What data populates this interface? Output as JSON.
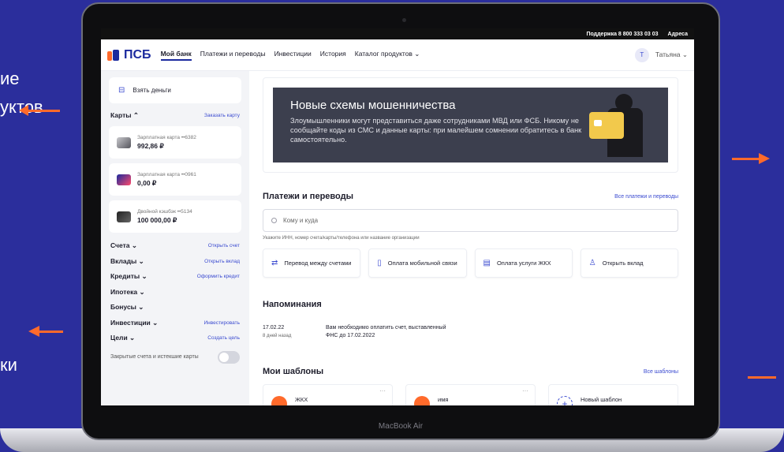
{
  "background": {
    "left_text_top": "ие\nуктов",
    "left_text_bottom": "ки"
  },
  "laptop_brand": "MacBook Air",
  "topbar": {
    "support": "Поддержка 8 800 333 03 03",
    "addresses": "Адреса"
  },
  "header": {
    "logo": "ПСБ",
    "nav": [
      "Мой банк",
      "Платежи и переводы",
      "Инвестиции",
      "История",
      "Каталог продуктов ⌄"
    ],
    "user_initial": "Т",
    "user_name": "Татьяна ⌄"
  },
  "sidebar": {
    "take_money": "Взять деньги",
    "cards_title": "Карты ⌃",
    "cards_link": "Заказать карту",
    "accounts": [
      {
        "name": "Зарплатная карта ••6382",
        "balance": "992,86 ₽"
      },
      {
        "name": "Зарплатная карта ••0961",
        "balance": "0,00 ₽"
      },
      {
        "name": "Двойной кэшбэк ••5134",
        "balance": "100 000,00 ₽"
      }
    ],
    "sections": [
      {
        "label": "Счета ⌄",
        "link": "Открыть счет"
      },
      {
        "label": "Вклады ⌄",
        "link": "Открыть вклад"
      },
      {
        "label": "Кредиты ⌄",
        "link": "Оформить кредит"
      },
      {
        "label": "Ипотека ⌄",
        "link": ""
      },
      {
        "label": "Бонусы ⌄",
        "link": ""
      },
      {
        "label": "Инвестиции ⌄",
        "link": "Инвестировать"
      },
      {
        "label": "Цели ⌄",
        "link": "Создать цель"
      }
    ],
    "closed_label": "Закрытые счета и истекшие карты"
  },
  "banner": {
    "title": "Новые схемы мошенничества",
    "text": "Злоумышленники могут представиться даже сотрудниками МВД или ФСБ. Никому не сообщайте коды из СМС и данные карты: при малейшем сомнении обратитесь в банк самостоятельно."
  },
  "payments": {
    "title": "Платежи и переводы",
    "all_link": "Все платежи и переводы",
    "search_placeholder": "Кому и куда",
    "hint": "Укажите ИНН, номер счета/карты/телефона или название организации",
    "actions": [
      "Перевод между счетами",
      "Оплата мобильной связи",
      "Оплата услуги ЖКХ",
      "Открыть вклад"
    ]
  },
  "reminders": {
    "title": "Напоминания",
    "date": "17.02.22",
    "ago": "8 дней назад",
    "text_line1": "Вам необходимо оплатить счет, выставленный",
    "text_line2": "ФНС до 17.02.2022"
  },
  "templates": {
    "title": "Мои шаблоны",
    "all_link": "Все шаблоны",
    "items": [
      "ЖКХ",
      "имя",
      "Новый шаблон"
    ]
  },
  "colors": {
    "accent": "#3b4bd0",
    "brand": "#1b2a9e",
    "orange": "#ff6a2b",
    "background": "#2b2e9c"
  }
}
